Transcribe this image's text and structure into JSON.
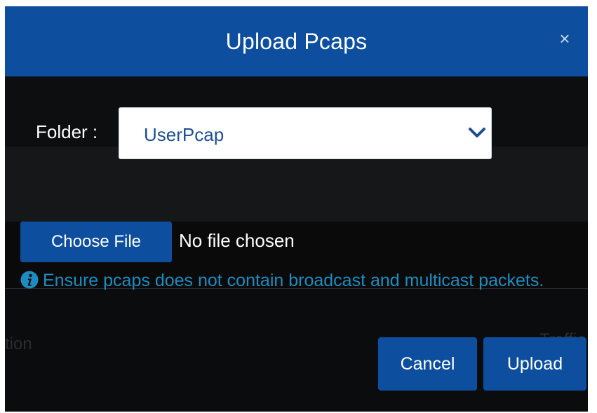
{
  "dialog": {
    "title": "Upload Pcaps",
    "close_symbol": "×"
  },
  "folder": {
    "label": "Folder :",
    "selected_value": "UserPcap",
    "dropdown_icon": "chevron-down-icon"
  },
  "file": {
    "choose_label": "Choose File",
    "status_text": "No file chosen"
  },
  "notice": {
    "icon": "info-icon",
    "text": "Ensure pcaps does not contain broadcast and multicast packets."
  },
  "background": {
    "partial_left_text": "tion",
    "partial_right_text": "Traffic"
  },
  "actions": {
    "cancel_label": "Cancel",
    "upload_label": "Upload"
  },
  "colors": {
    "header": "#0d4f9e",
    "button": "#0d4f9e",
    "info_text": "#1d8dc1",
    "select_text": "#1d4f94",
    "modal_bg": "#0b0c0d"
  }
}
